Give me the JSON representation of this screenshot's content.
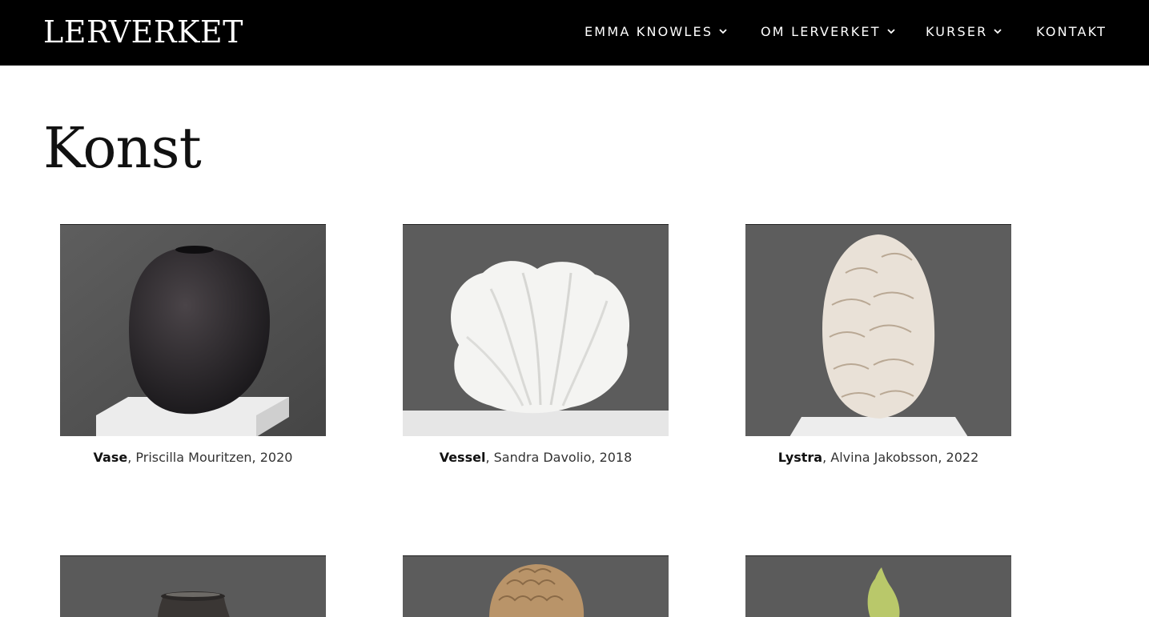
{
  "header": {
    "logo": "LERVERKET",
    "nav": [
      {
        "label": "EMMA KNOWLES",
        "has_dropdown": true
      },
      {
        "label": "OM LERVERKET",
        "has_dropdown": true
      },
      {
        "label": "KURSER",
        "has_dropdown": true
      },
      {
        "label": "KONTAKT",
        "has_dropdown": false
      }
    ]
  },
  "main": {
    "title": "Konst",
    "artworks": [
      {
        "title": "Vase",
        "details": ", Priscilla Mouritzen, 2020",
        "image_icon": "dark-vase-image"
      },
      {
        "title": "Vessel",
        "details": ", Sandra Davolio, 2018",
        "image_icon": "white-ruffled-vessel-image"
      },
      {
        "title": "Lystra",
        "details": ", Alvina Jakobsson, 2022",
        "image_icon": "petal-sculpture-image"
      }
    ]
  },
  "colors": {
    "header_bg": "#000000",
    "photo_bg": "#5a5a5a"
  }
}
